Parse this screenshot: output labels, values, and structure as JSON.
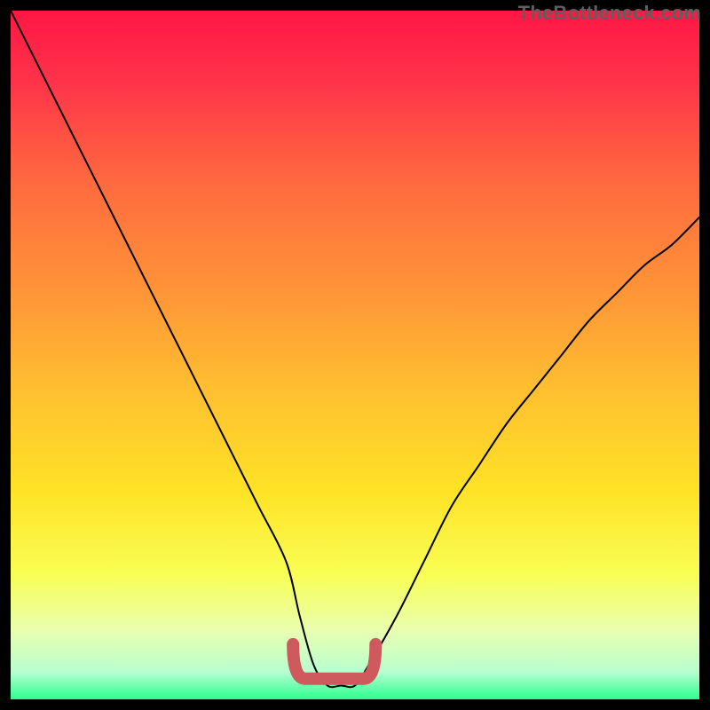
{
  "watermark": "TheBottleneck.com",
  "chart_data": {
    "type": "line",
    "title": "",
    "xlabel": "",
    "ylabel": "",
    "xlim": [
      0,
      100
    ],
    "ylim": [
      0,
      100
    ],
    "series": [
      {
        "name": "bottleneck-curve",
        "x": [
          0,
          4,
          8,
          12,
          16,
          20,
          24,
          28,
          32,
          36,
          40,
          42,
          44,
          46,
          48,
          50,
          52,
          56,
          60,
          64,
          68,
          72,
          76,
          80,
          84,
          88,
          92,
          96,
          100
        ],
        "y": [
          100,
          92,
          84,
          76,
          68,
          60,
          52,
          44,
          36,
          28,
          20,
          12,
          5,
          2,
          2,
          2,
          5,
          12,
          20,
          28,
          34,
          40,
          45,
          50,
          55,
          59,
          63,
          66,
          70
        ]
      }
    ],
    "annotations": [
      {
        "name": "optimal-band",
        "shape": "flat-bottom-u",
        "x_range": [
          41,
          53
        ],
        "y": 3,
        "color": "#cf5a5d",
        "stroke_width": 14
      }
    ],
    "background": {
      "type": "vertical-gradient",
      "stops": [
        {
          "offset": 0.0,
          "color": "#ff1744"
        },
        {
          "offset": 0.1,
          "color": "#ff324a"
        },
        {
          "offset": 0.25,
          "color": "#ff6a3f"
        },
        {
          "offset": 0.4,
          "color": "#ff9238"
        },
        {
          "offset": 0.55,
          "color": "#ffbf30"
        },
        {
          "offset": 0.7,
          "color": "#ffe326"
        },
        {
          "offset": 0.82,
          "color": "#f8ff55"
        },
        {
          "offset": 0.9,
          "color": "#e8ffb0"
        },
        {
          "offset": 0.96,
          "color": "#b8ffd0"
        },
        {
          "offset": 1.0,
          "color": "#2bff8f"
        }
      ]
    }
  }
}
